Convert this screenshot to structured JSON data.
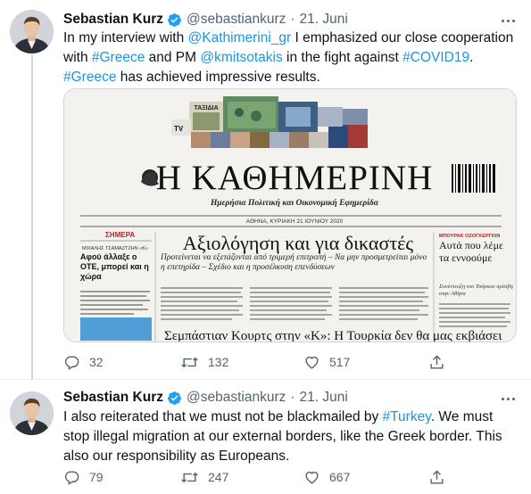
{
  "tweets": [
    {
      "author": {
        "name": "Sebastian Kurz",
        "handle": "@sebastiankurz"
      },
      "separator": "·",
      "date": "21. Juni",
      "lines": [
        [
          {
            "t": "In my interview with ",
            "link": false
          },
          {
            "t": "@Kathimerini_gr",
            "link": true
          },
          {
            "t": " I emphasized our close cooperation",
            "link": false
          }
        ],
        [
          {
            "t": "with ",
            "link": false
          },
          {
            "t": "#Greece",
            "link": true
          },
          {
            "t": " and PM ",
            "link": false
          },
          {
            "t": "@kmitsotakis",
            "link": true
          },
          {
            "t": " in the fight against ",
            "link": false
          },
          {
            "t": "#COVID19",
            "link": true
          },
          {
            "t": ".",
            "link": false
          }
        ],
        [
          {
            "t": "#Greece",
            "link": true
          },
          {
            "t": " has achieved impressive results.",
            "link": false
          }
        ]
      ],
      "media": {
        "masthead": "Η ΚΑΘΗΜΕΡΙΝΗ",
        "subtitle": "Ημερήσια Πολιτική και Οικονομική Εφημερίδα",
        "dateline": "ΑΘΗΝΑ, ΚΥΡΙΑΚΗ 21 ΙΟΥΝΙΟΥ 2020",
        "tag_travel": "ΤΑΞΙΔΙΑ",
        "tag_tv": "TV",
        "left_section": "ΣΗΜΕΡΑ",
        "left_byline": "ΜΙΧΑΛΗΣ ΤΣΑΜΑΖΤΖΗΝ «Κ»",
        "left_headline": "Αφού άλλαξε ο ΟΤΕ, μπορεί και η χώρα",
        "main_headline": "Αξιολόγηση και για δικαστές",
        "main_subhead": "Προτείνεται να εξετάζονται από τριμερή επιτροπή – Να μην προσμετρείται μόνο η επετηρίδα – Σχέδιο και η προσέλκυση επενδύσεων",
        "right_label": "ΜΠΟΥΡΑΚ ΟΖΟΓΚΕΡΓΚΙΝ",
        "right_headline": "Αυτά που λέμε τα εννοούμε",
        "right_sub": "Συνέντευξη του Τούρκου πρέσβη στην Αθήνα",
        "bottom_headline": "Σεμπάστιαν Κουρτς στην «Κ»: Η Τουρκία δεν θα μας εκβιάσει"
      },
      "actions": {
        "replies": "32",
        "retweets": "132",
        "likes": "517"
      }
    },
    {
      "author": {
        "name": "Sebastian Kurz",
        "handle": "@sebastiankurz"
      },
      "separator": "·",
      "date": "21. Juni",
      "lines": [
        [
          {
            "t": "I also reiterated that we must not be blackmailed by ",
            "link": false
          },
          {
            "t": "#Turkey",
            "link": true
          },
          {
            "t": ". We must",
            "link": false
          }
        ],
        [
          {
            "t": "stop illegal migration at our external borders, like the Greek border. This",
            "link": false
          }
        ],
        [
          {
            "t": "also our responsibility as Europeans.",
            "link": false
          }
        ]
      ],
      "actions": {
        "replies": "79",
        "retweets": "247",
        "likes": "667"
      }
    }
  ],
  "icons": {
    "verified": "verified-badge-icon",
    "more": "more-dots-icon",
    "reply": "reply-icon",
    "retweet": "retweet-icon",
    "like": "heart-icon",
    "share": "share-icon"
  },
  "colors": {
    "link": "#1b95e0",
    "text": "#0f1419",
    "secondary": "#536471",
    "verified": "#1da1f2",
    "border": "#e6ecf0"
  }
}
